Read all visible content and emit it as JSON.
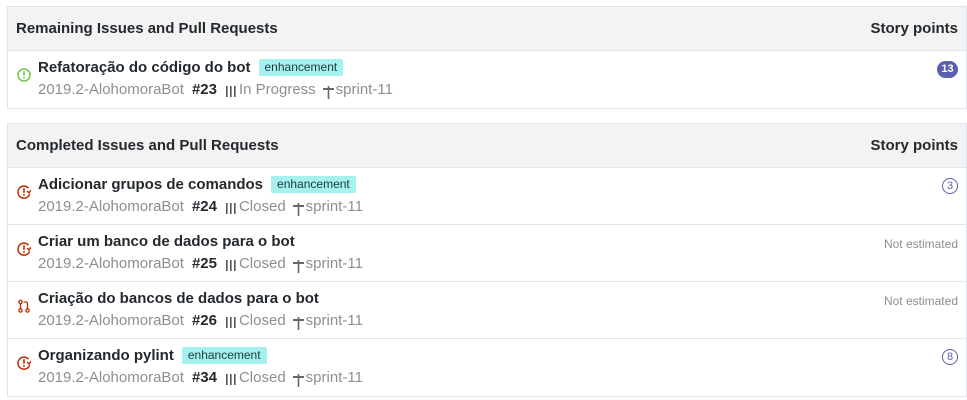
{
  "remaining": {
    "header": "Remaining Issues and Pull Requests",
    "points_header": "Story points",
    "items": [
      {
        "title": "Refatoração do código do bot",
        "label": "enhancement",
        "repo": "2019.2-AlohomoraBot",
        "number": "#23",
        "pipeline": "In Progress",
        "milestone": "sprint-11",
        "points": "13",
        "icon": "issue-open-icon"
      }
    ]
  },
  "completed": {
    "header": "Completed Issues and Pull Requests",
    "points_header": "Story points",
    "items": [
      {
        "title": "Adicionar grupos de comandos",
        "label": "enhancement",
        "repo": "2019.2-AlohomoraBot",
        "number": "#24",
        "pipeline": "Closed",
        "milestone": "sprint-11",
        "points": "3",
        "icon": "issue-closed-icon"
      },
      {
        "title": "Criar um banco de dados para o bot",
        "repo": "2019.2-AlohomoraBot",
        "number": "#25",
        "pipeline": "Closed",
        "milestone": "sprint-11",
        "points": "Not estimated",
        "icon": "issue-closed-icon"
      },
      {
        "title": "Criação do bancos de dados para o bot",
        "repo": "2019.2-AlohomoraBot",
        "number": "#26",
        "pipeline": "Closed",
        "milestone": "sprint-11",
        "points": "Not estimated",
        "icon": "pull-request-closed-icon"
      },
      {
        "title": "Organizando pylint",
        "label": "enhancement",
        "repo": "2019.2-AlohomoraBot",
        "number": "#34",
        "pipeline": "Closed",
        "milestone": "sprint-11",
        "points": "8",
        "icon": "issue-closed-icon"
      }
    ]
  },
  "colors": {
    "open_icon": "#6cc644",
    "closed_icon": "#bd2c00",
    "points_badge": "#5a5fb0",
    "label_bg": "#a5f1ef",
    "header_bg": "#f3f3f3",
    "muted_text": "#8a8f94"
  }
}
